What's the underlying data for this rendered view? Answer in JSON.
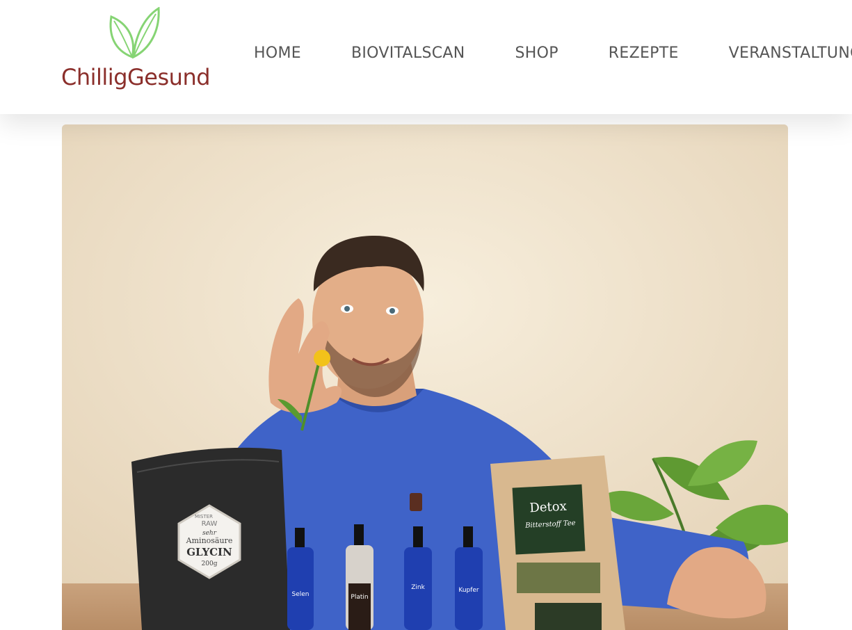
{
  "brand": {
    "name": "ChilligGesund",
    "logo_icon": "leaves-icon"
  },
  "nav": {
    "items": [
      {
        "label": "HOME"
      },
      {
        "label": "BIOVITALSCAN"
      },
      {
        "label": "SHOP"
      },
      {
        "label": "REZEPTE"
      },
      {
        "label": "VERANSTALTUNGEN"
      }
    ]
  },
  "hero": {
    "packaging_glycin": {
      "brand_small": "MISTER",
      "brand_big": "RAW",
      "line1": "sehr",
      "line2": "Aminosäure",
      "product": "GLYCIN",
      "weight": "200g"
    },
    "packaging_detox": {
      "title": "Detox",
      "subtitle": "Bitterstoff Tee"
    },
    "bottles": [
      {
        "label": "Selen"
      },
      {
        "label": "Platin"
      },
      {
        "label": "Zink"
      },
      {
        "label": "Kupfer"
      }
    ]
  },
  "colors": {
    "brand": "#8b2f2b",
    "leaf": "#7fcf6a",
    "nav_text": "#555555"
  }
}
